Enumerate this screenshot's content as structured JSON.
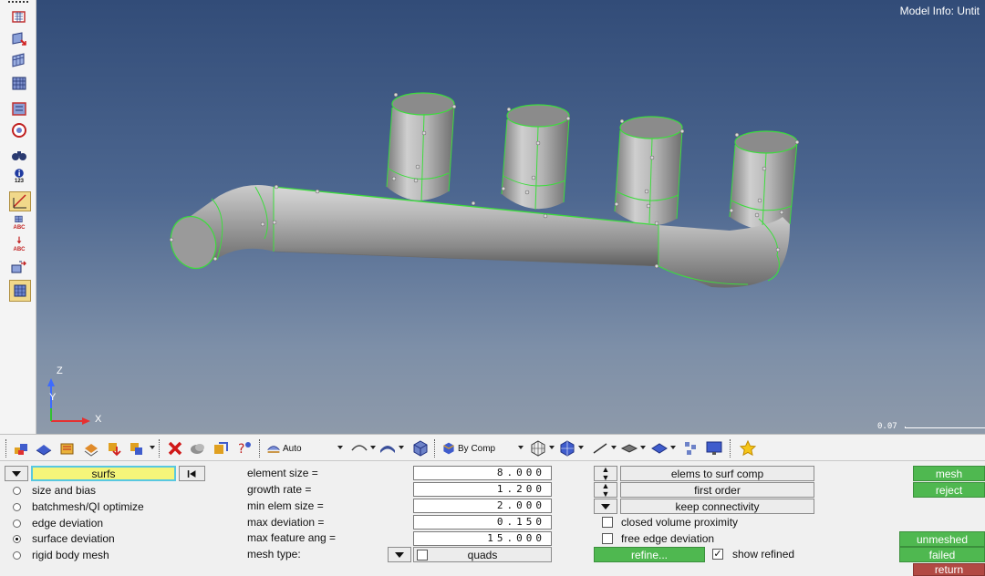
{
  "viewport": {
    "model_info": "Model Info: Untit",
    "axis_z": "Z",
    "axis_y": "Y",
    "axis_x": "X",
    "scale_label": "0.07"
  },
  "left_toolbar": {
    "icons": [
      "surface-edit-icon",
      "surface-add-icon",
      "surface-mesh-icon",
      "grid-mesh-icon",
      "surface-check-icon",
      "circle-target-icon",
      "binoculars-icon",
      "info-123-icon",
      "dimension-ruler-icon",
      "abc-label-icon",
      "abc-arrow-icon",
      "translate-icon",
      "screen-fit-icon"
    ],
    "info_label": "123",
    "abc_label": "ABC",
    "abc_label_2": "ABC"
  },
  "main_toolbar": {
    "display_mode": "Auto",
    "color_mode": "By Comp"
  },
  "panel": {
    "entity_selector": "surfs",
    "radio_options": [
      {
        "label": "size and bias",
        "selected": false
      },
      {
        "label": "batchmesh/QI optimize",
        "selected": false
      },
      {
        "label": "edge deviation",
        "selected": false
      },
      {
        "label": "surface deviation",
        "selected": true
      },
      {
        "label": "rigid body mesh",
        "selected": false
      }
    ],
    "fields": [
      {
        "label": "element size =",
        "value": "8.000"
      },
      {
        "label": "growth rate =",
        "value": "1.200"
      },
      {
        "label": "min elem size =",
        "value": "2.000"
      },
      {
        "label": "max deviation =",
        "value": "0.150"
      },
      {
        "label": "max feature ang =",
        "value": "15.000"
      }
    ],
    "mesh_type_label": "mesh type:",
    "mesh_type_value": "quads",
    "options": {
      "elems_to_surf_comp": "elems to surf comp",
      "first_order": "first order",
      "keep_connectivity": "keep connectivity",
      "closed_volume_proximity": "closed volume proximity",
      "free_edge_deviation": "free edge deviation",
      "refine": "refine...",
      "show_refined": "show refined"
    },
    "actions": {
      "mesh": "mesh",
      "reject": "reject",
      "unmeshed": "unmeshed",
      "failed": "failed",
      "return": "return"
    },
    "colors": {
      "accent_green": "#4fb850",
      "return_red": "#b24a44",
      "selector_yellow": "#f5f57a",
      "edge_green": "#3ddc3d"
    }
  }
}
